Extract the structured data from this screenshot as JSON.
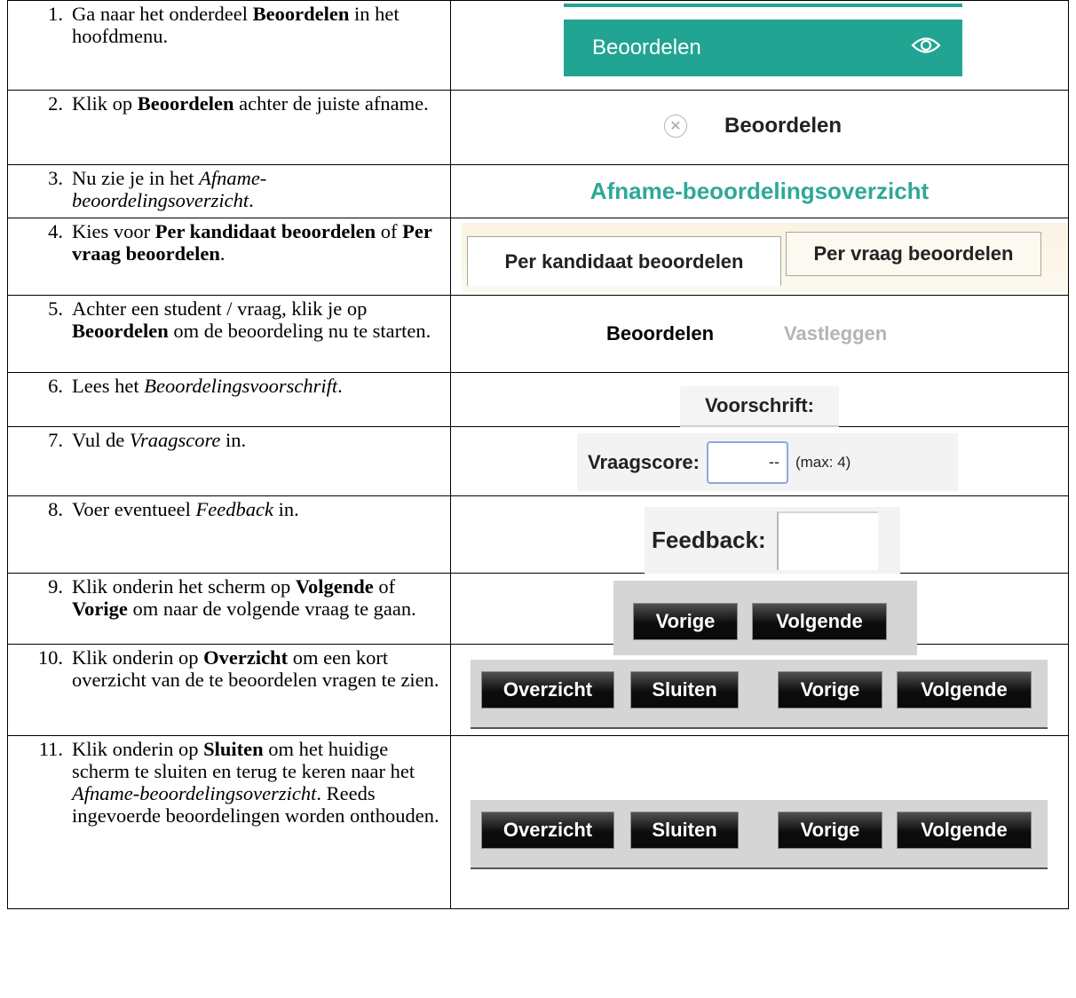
{
  "steps": [
    {
      "num": "1.",
      "parts": [
        {
          "t": "Ga naar het onderdeel "
        },
        {
          "t": "Beoordelen",
          "s": "b"
        },
        {
          "t": " in het hoofdmenu."
        }
      ]
    },
    {
      "num": "2.",
      "parts": [
        {
          "t": "Klik op "
        },
        {
          "t": "Beoordelen",
          "s": "b"
        },
        {
          "t": " achter de juiste afname."
        }
      ]
    },
    {
      "num": "3.",
      "parts": [
        {
          "t": "Nu zie je in het "
        },
        {
          "t": "Afname-beoordelingsoverzicht",
          "s": "i"
        },
        {
          "t": "."
        }
      ]
    },
    {
      "num": "4.",
      "parts": [
        {
          "t": "Kies voor "
        },
        {
          "t": "Per kandidaat beoordelen",
          "s": "b"
        },
        {
          "t": " of "
        },
        {
          "t": "Per vraag beoordelen",
          "s": "b"
        },
        {
          "t": "."
        }
      ]
    },
    {
      "num": "5.",
      "parts": [
        {
          "t": "Achter een student / vraag, klik je op "
        },
        {
          "t": "Beoordelen",
          "s": "b"
        },
        {
          "t": " om de beoordeling nu te starten."
        }
      ]
    },
    {
      "num": "6.",
      "parts": [
        {
          "t": "Lees het "
        },
        {
          "t": "Beoordelingsvoorschrift",
          "s": "i"
        },
        {
          "t": "."
        }
      ]
    },
    {
      "num": "7.",
      "parts": [
        {
          "t": "Vul de "
        },
        {
          "t": "Vraagscore",
          "s": "i"
        },
        {
          "t": " in."
        }
      ]
    },
    {
      "num": "8.",
      "parts": [
        {
          "t": "Voer eventueel "
        },
        {
          "t": "Feedback",
          "s": "i"
        },
        {
          "t": " in."
        }
      ]
    },
    {
      "num": "9.",
      "parts": [
        {
          "t": "Klik onderin het scherm op "
        },
        {
          "t": "Volgende",
          "s": "b"
        },
        {
          "t": " of "
        },
        {
          "t": "Vorige",
          "s": "b"
        },
        {
          "t": " om naar de volgende vraag te gaan."
        }
      ]
    },
    {
      "num": "10.",
      "parts": [
        {
          "t": "Klik onderin op "
        },
        {
          "t": "Overzicht",
          "s": "b"
        },
        {
          "t": " om een kort overzicht van de te beoordelen vragen te zien."
        }
      ]
    },
    {
      "num": "11.",
      "parts": [
        {
          "t": "Klik onderin op "
        },
        {
          "t": "Sluiten",
          "s": "b"
        },
        {
          "t": " om het huidige scherm te sluiten en terug te keren naar het "
        },
        {
          "t": "Afname-beoordelingsoverzicht",
          "s": "i"
        },
        {
          "t": ". Reeds ingevoerde beoordelingen worden onthouden."
        }
      ]
    }
  ],
  "ui": {
    "menu_label": "Beoordelen",
    "row2_label": "Beoordelen",
    "row3_title": "Afname-beoordelingsoverzicht",
    "tab_candidate": "Per kandidaat beoordelen",
    "tab_question": "Per vraag beoordelen",
    "link_beoordelen": "Beoordelen",
    "link_vastleggen": "Vastleggen",
    "voorschrift": "Voorschrift:",
    "vraagscore_label": "Vraagscore:",
    "vraagscore_value": "--",
    "vraagscore_max": "(max: 4)",
    "feedback_label": "Feedback:",
    "btn_vorige": "Vorige",
    "btn_volgende": "Volgende",
    "btn_overzicht": "Overzicht",
    "btn_sluiten": "Sluiten"
  },
  "colors": {
    "accent": "#22a492",
    "title": "#2ea899"
  }
}
